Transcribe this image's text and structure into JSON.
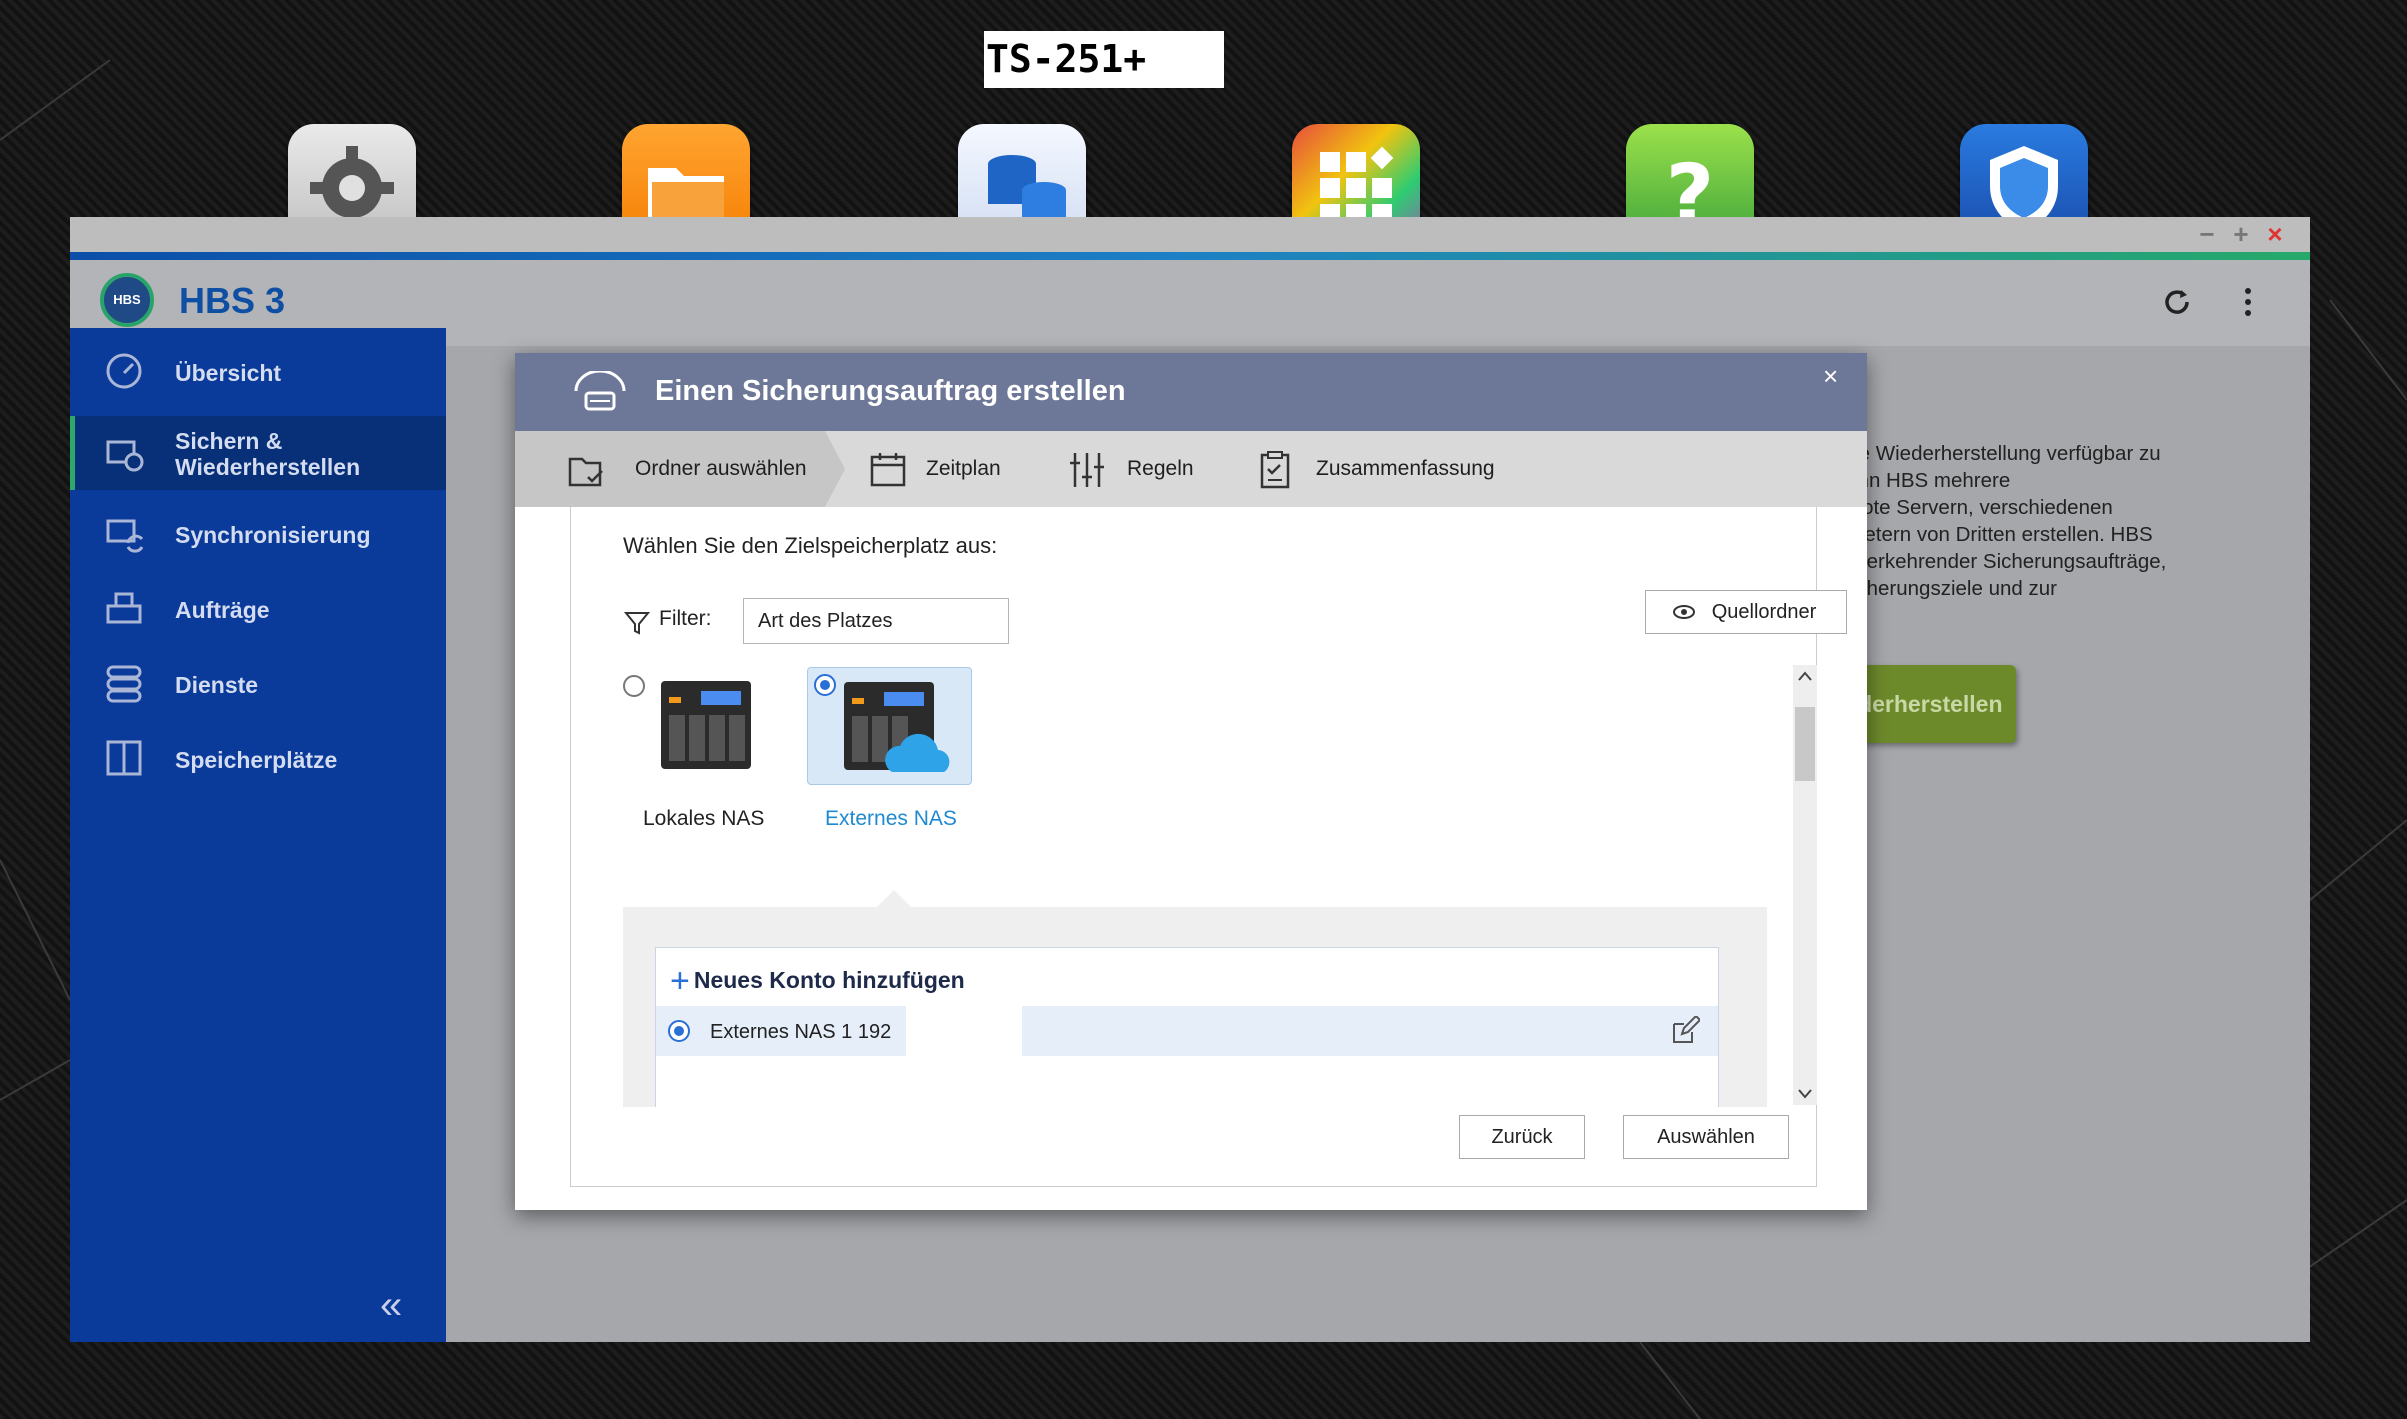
{
  "desktop": {
    "title": "TS-251+"
  },
  "window": {
    "app_title": "HBS 3",
    "logo_text": "HBS",
    "minimize": "−",
    "maximize": "+",
    "close": "×"
  },
  "sidebar": {
    "items": [
      {
        "label": "Übersicht",
        "icon": "gauge-icon"
      },
      {
        "label": "Sichern &\nWiederherstellen",
        "icon": "backup-restore-icon"
      },
      {
        "label": "Synchronisierung",
        "icon": "sync-icon"
      },
      {
        "label": "Aufträge",
        "icon": "jobs-icon"
      },
      {
        "label": "Dienste",
        "icon": "services-icon"
      },
      {
        "label": "Speicherplätze",
        "icon": "storage-icon"
      }
    ],
    "collapse": "«"
  },
  "content": {
    "description": "d für die Wiederherstellung verfügbar zu\nden kann HBS mehrere\nn, Remote Servern, verschiedenen\nud Anbietern von Dritten erstellen. HBS\nng wiederkehrender Sicherungsaufträge,\nhrer Sicherungsziele und zur",
    "restore_button": "wiederherstellen"
  },
  "dialog": {
    "title": "Einen Sicherungsauftrag erstellen",
    "close": "×",
    "steps": [
      "Ordner auswählen",
      "Zeitplan",
      "Regeln",
      "Zusammenfassung"
    ],
    "prompt": "Wählen Sie den Zielspeicherplatz aus:",
    "filter_label": "Filter:",
    "filter_value": "Art des Platzes",
    "source_button": "Quellordner",
    "options": [
      {
        "label": "Lokales NAS",
        "selected": false
      },
      {
        "label": "Externes NAS",
        "selected": true
      }
    ],
    "add_account": "Neues Konto hinzufügen",
    "account_name": "Externes NAS 1  192",
    "back_button": "Zurück",
    "select_button": "Auswählen"
  },
  "colors": {
    "accent": "#0a3a9a",
    "selected_blue": "#2a6fd6",
    "dialog_header": "#6d7797",
    "green": "#6d8a2b"
  }
}
